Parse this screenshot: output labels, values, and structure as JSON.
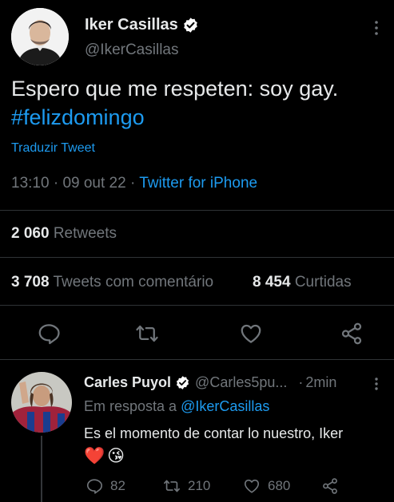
{
  "main_tweet": {
    "author_name": "Iker Casillas",
    "author_handle": "@IkerCasillas",
    "text": "Espero que me respeten: soy gay.",
    "hashtag": "#felizdomingo",
    "translate_label": "Traduzir Tweet",
    "time": "13:10",
    "separator1": "·",
    "date": "09 out 22",
    "separator2": "·",
    "source": "Twitter for iPhone",
    "retweets_count": "2 060",
    "retweets_label": "Retweets",
    "quote_count": "3 708",
    "quote_label": "Tweets com comentário",
    "likes_count": "8 454",
    "likes_label": "Curtidas"
  },
  "reply": {
    "author_name": "Carles Puyol",
    "author_handle": "@Carles5pu...",
    "separator": "·",
    "time": "2min",
    "replying_label": "Em resposta a",
    "replying_handle": "@IkerCasillas",
    "text": "Es el momento de contar lo nuestro, Iker",
    "emojis": [
      "❤️",
      "😘"
    ],
    "reply_count": "82",
    "retweet_count": "210",
    "like_count": "680"
  },
  "colors": {
    "background": "#000000",
    "text": "#e7e9ea",
    "muted": "#71767b",
    "accent": "#1d9bf0",
    "divider": "#2f3336"
  },
  "icons": [
    "verified-badge-icon",
    "more-options-icon",
    "reply-icon",
    "retweet-icon",
    "like-icon",
    "share-icon"
  ]
}
